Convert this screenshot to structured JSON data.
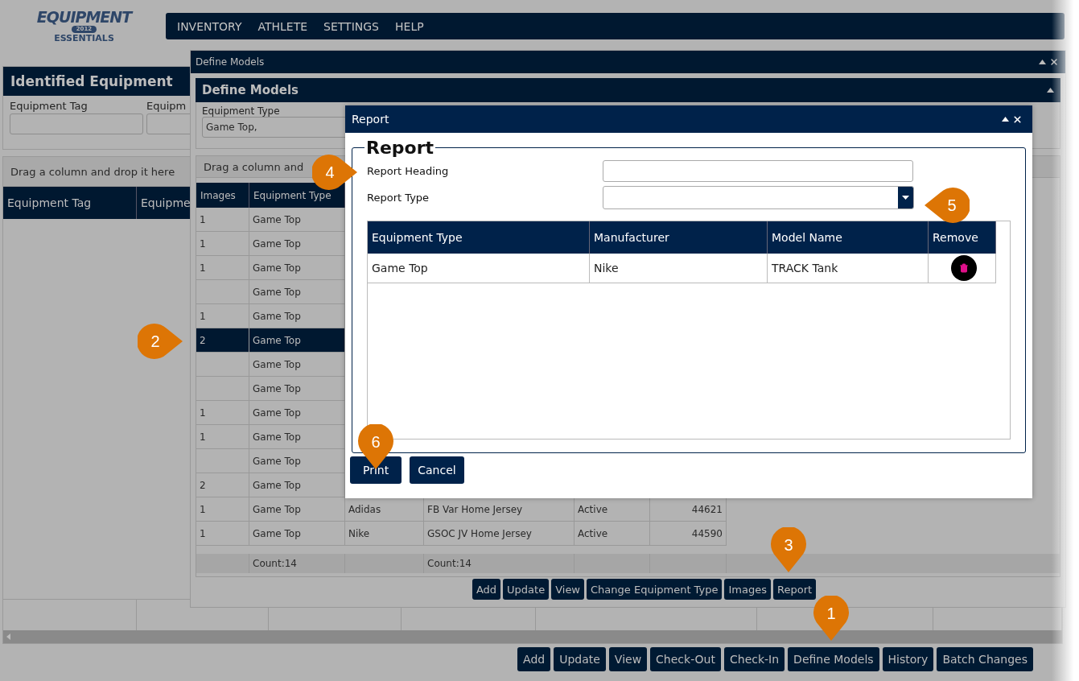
{
  "logo": {
    "top": "EQUIPMENT",
    "year": "2012",
    "bottom": "ESSENTIALS"
  },
  "nav": [
    "INVENTORY",
    "ATHLETE",
    "SETTINGS",
    "HELP"
  ],
  "identified_equipment": {
    "title": "Identified Equipment",
    "fields": [
      {
        "label": "Equipment Tag"
      },
      {
        "label": "Equipm"
      }
    ]
  },
  "main_grid": {
    "group_hint": "Drag a column and drop it here",
    "columns": [
      "Equipment Tag",
      "Equipme"
    ]
  },
  "toolbar": [
    "Add",
    "Update",
    "View",
    "Check-Out",
    "Check-In",
    "Define Models",
    "History",
    "Batch Changes"
  ],
  "define_models": {
    "window_title": "Define Models",
    "panel_title": "Define Models",
    "equipment_type": {
      "label": "Equipment Type",
      "value": "Game Top,"
    },
    "grid": {
      "group_hint": "Drag a column and",
      "columns": [
        "Images",
        "Equipment Type"
      ],
      "rows": [
        {
          "images": "1",
          "equipment_type": "Game Top",
          "selected": false
        },
        {
          "images": "1",
          "equipment_type": "Game Top",
          "selected": false
        },
        {
          "images": "1",
          "equipment_type": "Game Top",
          "selected": false
        },
        {
          "equipment_type": "Game Top",
          "selected": false
        },
        {
          "images": "1",
          "equipment_type": "Game Top",
          "selected": false
        },
        {
          "images": "2",
          "equipment_type": "Game Top",
          "selected": true
        },
        {
          "equipment_type": "Game Top",
          "selected": false
        },
        {
          "equipment_type": "Game Top",
          "selected": false
        },
        {
          "images": "1",
          "equipment_type": "Game Top",
          "selected": false
        },
        {
          "images": "1",
          "equipment_type": "Game Top",
          "selected": false
        },
        {
          "equipment_type": "Game Top",
          "selected": false
        },
        {
          "images": "2",
          "equipment_type": "Game Top",
          "selected": false
        },
        {
          "images": "1",
          "equipment_type": "Game Top",
          "column_3": "Adidas",
          "column_4": "FB Var Home Jersey",
          "column_5": "Active",
          "column_6": "44621",
          "selected": false
        },
        {
          "images": "1",
          "equipment_type": "Game Top",
          "column_3": "Nike",
          "column_4": "GSOC JV Home Jersey",
          "column_5": "Active",
          "column_6": "44590",
          "selected": false
        }
      ],
      "footer": {
        "column_2": "Count:14",
        "column_4": "Count:14"
      }
    },
    "buttons": [
      "Add",
      "Update",
      "View",
      "Change Equipment Type",
      "Images",
      "Report"
    ]
  },
  "report": {
    "window_title": "Report",
    "legend": "Report",
    "fields": [
      {
        "label": "Report Heading",
        "kind": "text"
      },
      {
        "label": "Report Type",
        "kind": "select"
      }
    ],
    "table": {
      "columns": [
        "Equipment Type",
        "Manufacturer",
        "Model Name",
        "Remove"
      ],
      "rows": [
        {
          "equipment_type": "Game Top",
          "manufacturer": "Nike",
          "model_name": "TRACK Tank"
        }
      ]
    },
    "buttons": [
      "Print",
      "Cancel"
    ]
  },
  "callouts": [
    {
      "label": "1",
      "kind": "down"
    },
    {
      "label": "2",
      "kind": "right"
    },
    {
      "label": "3",
      "kind": "down"
    },
    {
      "label": "4",
      "kind": "right"
    },
    {
      "label": "5",
      "kind": "left"
    },
    {
      "label": "6",
      "kind": "down"
    }
  ]
}
